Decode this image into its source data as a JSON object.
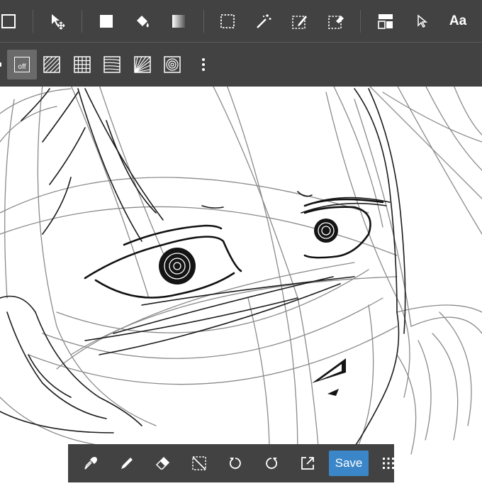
{
  "app": {
    "accent_color": "#3a86c8",
    "toolbar_color": "#424242"
  },
  "top_toolbar": {
    "tools": [
      {
        "name": "frame",
        "icon": "square-outline-icon"
      },
      {
        "name": "move",
        "icon": "move-arrow-icon"
      },
      {
        "name": "fill-rect",
        "icon": "filled-square-icon"
      },
      {
        "name": "bucket",
        "icon": "paint-bucket-icon"
      },
      {
        "name": "gradient",
        "icon": "gradient-icon"
      },
      {
        "name": "select-rect",
        "icon": "dotted-rect-select-icon"
      },
      {
        "name": "magic-wand",
        "icon": "magic-wand-icon"
      },
      {
        "name": "select-pen",
        "icon": "select-pen-icon"
      },
      {
        "name": "select-eraser",
        "icon": "select-eraser-icon"
      },
      {
        "name": "frame-divider",
        "icon": "panel-divider-icon"
      },
      {
        "name": "pointer",
        "icon": "pointer-icon"
      }
    ],
    "text_tool_label": "Aa"
  },
  "tone_toolbar": {
    "off_label": "off",
    "tones": [
      {
        "name": "off",
        "icon": "tone-off-icon",
        "selected": true
      },
      {
        "name": "diagonal",
        "icon": "diagonal-lines-icon",
        "selected": false
      },
      {
        "name": "grid",
        "icon": "grid-tone-icon",
        "selected": false
      },
      {
        "name": "horizontal",
        "icon": "horizontal-lines-icon",
        "selected": false
      },
      {
        "name": "radial",
        "icon": "radial-lines-icon",
        "selected": false
      },
      {
        "name": "concentric",
        "icon": "concentric-circles-icon",
        "selected": false
      }
    ]
  },
  "bottom_toolbar": {
    "tools": [
      {
        "name": "eyedropper",
        "icon": "eyedropper-icon"
      },
      {
        "name": "pen",
        "icon": "pen-icon"
      },
      {
        "name": "eraser",
        "icon": "eraser-icon"
      },
      {
        "name": "deselect",
        "icon": "deselect-icon"
      },
      {
        "name": "undo",
        "icon": "undo-icon"
      },
      {
        "name": "redo",
        "icon": "redo-icon"
      },
      {
        "name": "export",
        "icon": "export-icon"
      }
    ],
    "save_label": "Save",
    "menu_icon": "grid-menu-icon"
  }
}
